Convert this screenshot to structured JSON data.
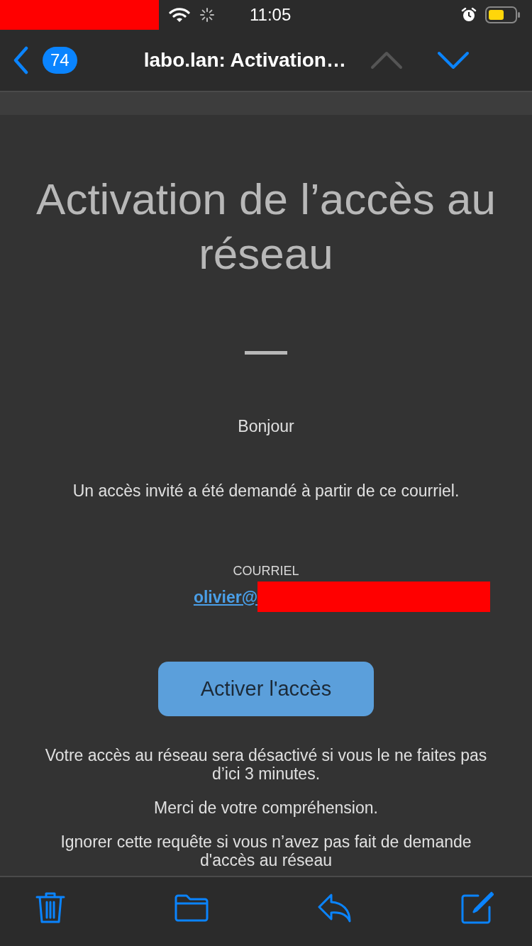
{
  "status_bar": {
    "time": "11:05"
  },
  "nav": {
    "unread_count": "74",
    "title": "labo.lan: Activation…",
    "previous_disabled": true,
    "next_disabled": false
  },
  "email": {
    "heading": "Activation de l’accès au réseau",
    "greeting": "Bonjour",
    "intro": "Un accès invité a été demandé à partir de ce courriel.",
    "email_label": "COURRIEL",
    "email_link": "olivier@",
    "action_button": "Activer l'accès",
    "paragraphs": [
      "Votre accès au réseau sera désactivé si vous le ne faites pas d’ici 3 minutes.",
      "Merci de votre compréhension.",
      "Ignorer cette requête si vous n’avez pas fait de demande d'accès au réseau"
    ]
  }
}
